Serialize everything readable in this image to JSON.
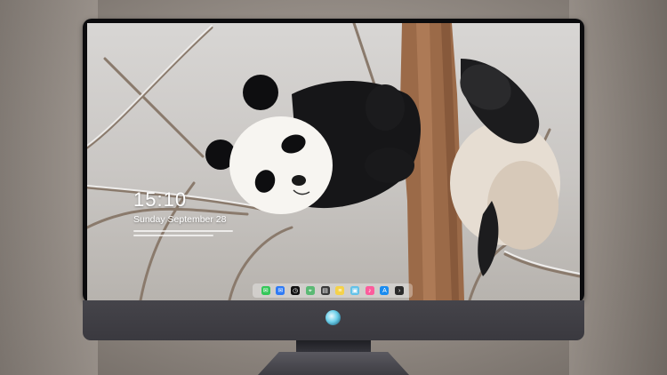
{
  "lockscreen": {
    "time": "15:10",
    "date": "Sunday September 28"
  },
  "wallpaper": {
    "subject": "panda-climbing-snowy-tree"
  },
  "dock": {
    "apps": [
      {
        "name": "messages-icon",
        "color": "#34c759",
        "glyph": "✉"
      },
      {
        "name": "mail-icon",
        "color": "#2f7bf5",
        "glyph": "✉"
      },
      {
        "name": "clock-icon",
        "color": "#111111",
        "glyph": "◷"
      },
      {
        "name": "maps-icon",
        "color": "#5bb974",
        "glyph": "⌖"
      },
      {
        "name": "clapper-icon",
        "color": "#3a3a3a",
        "glyph": "▤"
      },
      {
        "name": "notes-icon",
        "color": "#f5d24a",
        "glyph": "≡"
      },
      {
        "name": "photos-icon",
        "color": "#64c2e8",
        "glyph": "▣"
      },
      {
        "name": "music-icon",
        "color": "#fc5c9c",
        "glyph": "♪"
      },
      {
        "name": "app-store-icon",
        "color": "#1a8cf0",
        "glyph": "A"
      },
      {
        "name": "terminal-icon",
        "color": "#2b2b2b",
        "glyph": "›"
      }
    ]
  },
  "colors": {
    "bezel": "#0b0b0d",
    "chin": "#3f3e44",
    "accent_logo": "#6dd0ea"
  }
}
